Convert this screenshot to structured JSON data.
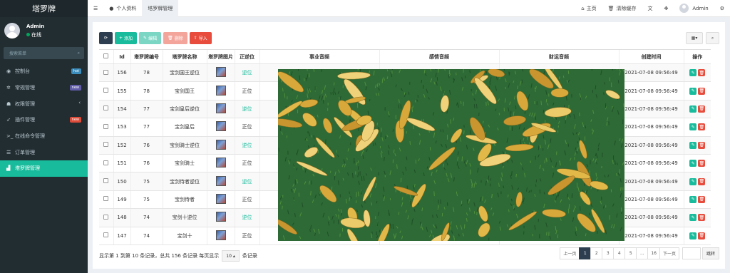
{
  "sidebar": {
    "logo": "塔罗牌",
    "user": {
      "name": "Admin",
      "status": "在线"
    },
    "search_placeholder": "搜索菜单",
    "items": [
      {
        "label": "控制台",
        "icon": "dashboard-icon",
        "badge": "hot",
        "badge_color": "#3c8dbc"
      },
      {
        "label": "常规管理",
        "icon": "cogs-icon",
        "badge": "new",
        "badge_color": "#605ca8"
      },
      {
        "label": "权限管理",
        "icon": "group-icon",
        "caret": "‹"
      },
      {
        "label": "插件管理",
        "icon": "rocket-icon",
        "badge": "new",
        "badge_color": "#dd4b39"
      },
      {
        "label": "在线命令管理",
        "icon": "terminal-icon"
      },
      {
        "label": "订单管理",
        "icon": "list-icon"
      },
      {
        "label": "塔罗牌管理",
        "icon": "chart-icon",
        "active": true
      }
    ]
  },
  "topbar": {
    "tabs": [
      {
        "label": "个人资料",
        "icon": "user-icon"
      },
      {
        "label": "塔罗牌管理",
        "active": true
      }
    ],
    "home": "主页",
    "clear_cache": "清除缓存",
    "admin": "Admin"
  },
  "toolbar": {
    "add": "添加",
    "edit": "编辑",
    "delete": "删除",
    "import": "导入"
  },
  "table": {
    "headers": [
      "Id",
      "塔罗牌编号",
      "塔罗牌名称",
      "塔罗牌图片",
      "正逆位",
      "事业音频",
      "感情音频",
      "财运音频",
      "创建时间",
      "操作"
    ],
    "rows": [
      {
        "id": "156",
        "no": "78",
        "name": "宝剑国王逆位",
        "pos": "逆位",
        "time": "2021-07-08 09:56:49"
      },
      {
        "id": "155",
        "no": "78",
        "name": "宝剑国王",
        "pos": "正位",
        "time": "2021-07-08 09:56:49"
      },
      {
        "id": "154",
        "no": "77",
        "name": "宝剑皇后逆位",
        "pos": "逆位",
        "time": "2021-07-08 09:56:49"
      },
      {
        "id": "153",
        "no": "77",
        "name": "宝剑皇后",
        "pos": "正位",
        "time": "2021-07-08 09:56:49"
      },
      {
        "id": "152",
        "no": "76",
        "name": "宝剑骑士逆位",
        "pos": "逆位",
        "time": "2021-07-08 09:56:49"
      },
      {
        "id": "151",
        "no": "76",
        "name": "宝剑骑士",
        "pos": "正位",
        "time": "2021-07-08 09:56:49"
      },
      {
        "id": "150",
        "no": "75",
        "name": "宝剑侍者逆位",
        "pos": "逆位",
        "time": "2021-07-08 09:56:49"
      },
      {
        "id": "149",
        "no": "75",
        "name": "宝剑侍者",
        "pos": "正位",
        "time": "2021-07-08 09:56:49"
      },
      {
        "id": "148",
        "no": "74",
        "name": "宝剑十逆位",
        "pos": "逆位",
        "time": "2021-07-08 09:56:49"
      },
      {
        "id": "147",
        "no": "74",
        "name": "宝剑十",
        "pos": "正位",
        "time": "2021-07-08 09:56:49"
      }
    ]
  },
  "footer": {
    "summary": "显示第 1 到第 10 条记录，总共 156 条记录 每页显示",
    "page_size": "10",
    "suffix": "条记录"
  },
  "pagination": {
    "prev": "上一页",
    "pages": [
      "1",
      "2",
      "3",
      "4",
      "5",
      "...",
      "16"
    ],
    "next": "下一页",
    "go": "跳转"
  }
}
